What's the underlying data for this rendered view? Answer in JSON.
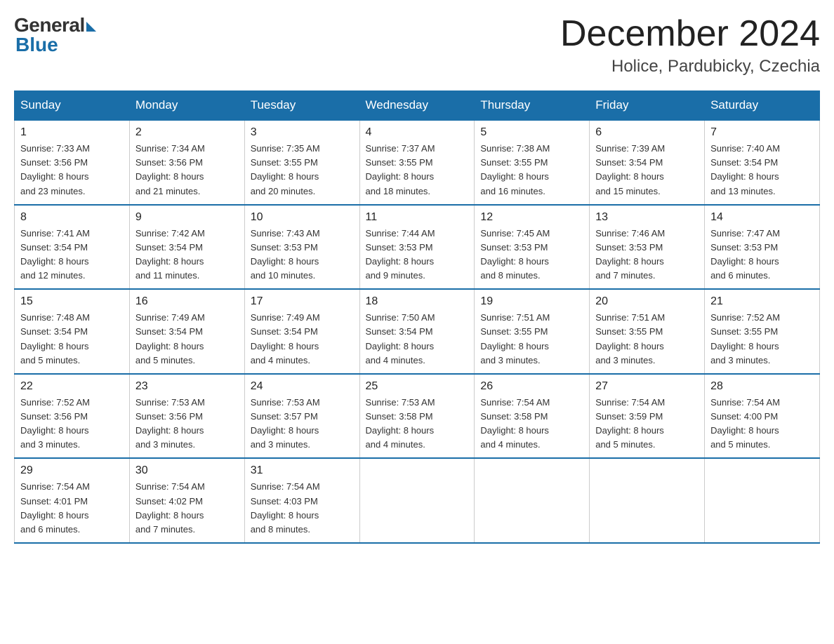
{
  "logo": {
    "general": "General",
    "blue": "Blue"
  },
  "header": {
    "title": "December 2024",
    "location": "Holice, Pardubicky, Czechia"
  },
  "days_of_week": [
    "Sunday",
    "Monday",
    "Tuesday",
    "Wednesday",
    "Thursday",
    "Friday",
    "Saturday"
  ],
  "weeks": [
    [
      {
        "day": "1",
        "sunrise": "7:33 AM",
        "sunset": "3:56 PM",
        "daylight": "8 hours and 23 minutes."
      },
      {
        "day": "2",
        "sunrise": "7:34 AM",
        "sunset": "3:56 PM",
        "daylight": "8 hours and 21 minutes."
      },
      {
        "day": "3",
        "sunrise": "7:35 AM",
        "sunset": "3:55 PM",
        "daylight": "8 hours and 20 minutes."
      },
      {
        "day": "4",
        "sunrise": "7:37 AM",
        "sunset": "3:55 PM",
        "daylight": "8 hours and 18 minutes."
      },
      {
        "day": "5",
        "sunrise": "7:38 AM",
        "sunset": "3:55 PM",
        "daylight": "8 hours and 16 minutes."
      },
      {
        "day": "6",
        "sunrise": "7:39 AM",
        "sunset": "3:54 PM",
        "daylight": "8 hours and 15 minutes."
      },
      {
        "day": "7",
        "sunrise": "7:40 AM",
        "sunset": "3:54 PM",
        "daylight": "8 hours and 13 minutes."
      }
    ],
    [
      {
        "day": "8",
        "sunrise": "7:41 AM",
        "sunset": "3:54 PM",
        "daylight": "8 hours and 12 minutes."
      },
      {
        "day": "9",
        "sunrise": "7:42 AM",
        "sunset": "3:54 PM",
        "daylight": "8 hours and 11 minutes."
      },
      {
        "day": "10",
        "sunrise": "7:43 AM",
        "sunset": "3:53 PM",
        "daylight": "8 hours and 10 minutes."
      },
      {
        "day": "11",
        "sunrise": "7:44 AM",
        "sunset": "3:53 PM",
        "daylight": "8 hours and 9 minutes."
      },
      {
        "day": "12",
        "sunrise": "7:45 AM",
        "sunset": "3:53 PM",
        "daylight": "8 hours and 8 minutes."
      },
      {
        "day": "13",
        "sunrise": "7:46 AM",
        "sunset": "3:53 PM",
        "daylight": "8 hours and 7 minutes."
      },
      {
        "day": "14",
        "sunrise": "7:47 AM",
        "sunset": "3:53 PM",
        "daylight": "8 hours and 6 minutes."
      }
    ],
    [
      {
        "day": "15",
        "sunrise": "7:48 AM",
        "sunset": "3:54 PM",
        "daylight": "8 hours and 5 minutes."
      },
      {
        "day": "16",
        "sunrise": "7:49 AM",
        "sunset": "3:54 PM",
        "daylight": "8 hours and 5 minutes."
      },
      {
        "day": "17",
        "sunrise": "7:49 AM",
        "sunset": "3:54 PM",
        "daylight": "8 hours and 4 minutes."
      },
      {
        "day": "18",
        "sunrise": "7:50 AM",
        "sunset": "3:54 PM",
        "daylight": "8 hours and 4 minutes."
      },
      {
        "day": "19",
        "sunrise": "7:51 AM",
        "sunset": "3:55 PM",
        "daylight": "8 hours and 3 minutes."
      },
      {
        "day": "20",
        "sunrise": "7:51 AM",
        "sunset": "3:55 PM",
        "daylight": "8 hours and 3 minutes."
      },
      {
        "day": "21",
        "sunrise": "7:52 AM",
        "sunset": "3:55 PM",
        "daylight": "8 hours and 3 minutes."
      }
    ],
    [
      {
        "day": "22",
        "sunrise": "7:52 AM",
        "sunset": "3:56 PM",
        "daylight": "8 hours and 3 minutes."
      },
      {
        "day": "23",
        "sunrise": "7:53 AM",
        "sunset": "3:56 PM",
        "daylight": "8 hours and 3 minutes."
      },
      {
        "day": "24",
        "sunrise": "7:53 AM",
        "sunset": "3:57 PM",
        "daylight": "8 hours and 3 minutes."
      },
      {
        "day": "25",
        "sunrise": "7:53 AM",
        "sunset": "3:58 PM",
        "daylight": "8 hours and 4 minutes."
      },
      {
        "day": "26",
        "sunrise": "7:54 AM",
        "sunset": "3:58 PM",
        "daylight": "8 hours and 4 minutes."
      },
      {
        "day": "27",
        "sunrise": "7:54 AM",
        "sunset": "3:59 PM",
        "daylight": "8 hours and 5 minutes."
      },
      {
        "day": "28",
        "sunrise": "7:54 AM",
        "sunset": "4:00 PM",
        "daylight": "8 hours and 5 minutes."
      }
    ],
    [
      {
        "day": "29",
        "sunrise": "7:54 AM",
        "sunset": "4:01 PM",
        "daylight": "8 hours and 6 minutes."
      },
      {
        "day": "30",
        "sunrise": "7:54 AM",
        "sunset": "4:02 PM",
        "daylight": "8 hours and 7 minutes."
      },
      {
        "day": "31",
        "sunrise": "7:54 AM",
        "sunset": "4:03 PM",
        "daylight": "8 hours and 8 minutes."
      },
      null,
      null,
      null,
      null
    ]
  ],
  "labels": {
    "sunrise": "Sunrise:",
    "sunset": "Sunset:",
    "daylight": "Daylight:"
  }
}
